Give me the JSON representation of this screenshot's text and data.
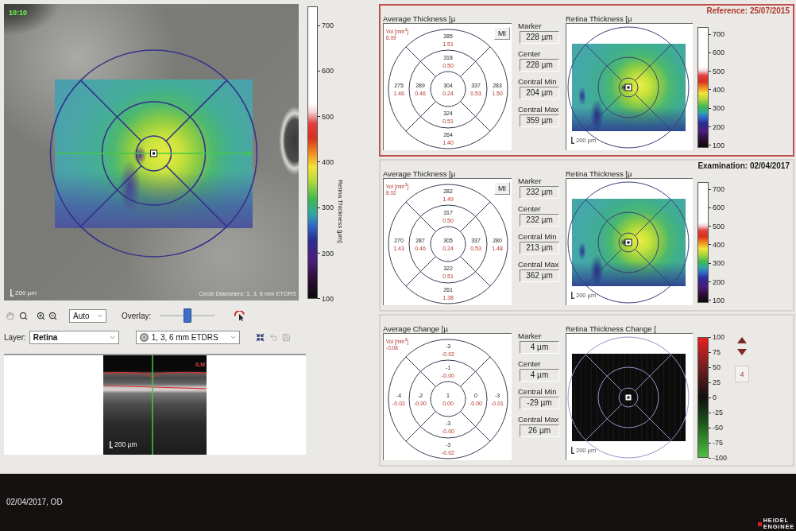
{
  "fundus": {
    "stamp": "10:10",
    "scale_label": "200 µm",
    "caption": "Circle Diameters: 1, 3, 6 mm ETDRS",
    "scale": {
      "title": "Retina Thickness [µm]",
      "ticks": [
        "700",
        "600",
        "500",
        "400",
        "300",
        "200",
        "100"
      ]
    }
  },
  "toolbar": {
    "zoom_mode": "Auto",
    "overlay_label": "Overlay:",
    "overlay": {
      "level": 0.5
    },
    "layer_label": "Layer:",
    "layer": "Retina",
    "grid": "1, 3, 6 mm ETDRS"
  },
  "bscan": {
    "layer_tag": "ILM",
    "scale_label": "200 µm"
  },
  "panels": [
    {
      "kind": "thickness",
      "highlighted": true,
      "heading": "Reference: 25/07/2015",
      "sector_title": "Average Thickness [µ",
      "volume_label": "Vol [mm$^{3}$]",
      "volume": "8.09",
      "mi": "MI",
      "sectors": [
        {
          "value": "285",
          "volume": "1.51"
        },
        {
          "value": "318",
          "volume": "0.50"
        },
        {
          "value": "275",
          "volume": "1.46"
        },
        {
          "value": "289",
          "volume": "0.46"
        },
        {
          "value": "304",
          "volume": "0.24"
        },
        {
          "value": "337",
          "volume": "0.53"
        },
        {
          "value": "283",
          "volume": "1.50"
        },
        {
          "value": "324",
          "volume": "0.51"
        },
        {
          "value": "264",
          "volume": "1.40"
        }
      ],
      "readings": [
        {
          "label": "Marker",
          "value": "228 µm"
        },
        {
          "label": "Center",
          "value": "228 µm"
        },
        {
          "label": "Central Min",
          "value": "204 µm"
        },
        {
          "label": "Central Max",
          "value": "359 µm"
        }
      ],
      "map_title": "Retina Thickness [µ",
      "map_scale": "200 µm",
      "ticks": [
        "700",
        "600",
        "500",
        "400",
        "300",
        "200",
        "100"
      ]
    },
    {
      "kind": "thickness",
      "highlighted": false,
      "heading": "Examination: 02/04/2017",
      "sector_title": "Average Thickness [µ",
      "volume_label": "Vol [mm$^{3}$]",
      "volume": "8.02",
      "mi": "MI",
      "sectors": [
        {
          "value": "282",
          "volume": "1.49"
        },
        {
          "value": "317",
          "volume": "0.50"
        },
        {
          "value": "270",
          "volume": "1.43"
        },
        {
          "value": "287",
          "volume": "0.46"
        },
        {
          "value": "305",
          "volume": "0.24"
        },
        {
          "value": "337",
          "volume": "0.53"
        },
        {
          "value": "280",
          "volume": "1.48"
        },
        {
          "value": "322",
          "volume": "0.51"
        },
        {
          "value": "261",
          "volume": "1.38"
        }
      ],
      "readings": [
        {
          "label": "Marker",
          "value": "232 µm"
        },
        {
          "label": "Center",
          "value": "232 µm"
        },
        {
          "label": "Central Min",
          "value": "213 µm"
        },
        {
          "label": "Central Max",
          "value": "362 µm"
        }
      ],
      "map_title": "Retina Thickness [µ",
      "map_scale": "200 µm",
      "ticks": [
        "700",
        "600",
        "500",
        "400",
        "300",
        "200",
        "100"
      ]
    },
    {
      "kind": "change",
      "highlighted": false,
      "sector_title": "Average Change [µ",
      "volume_label": "Vol [mm$^{3}$]",
      "volume": "-0.08",
      "sectors": [
        {
          "value": "-3",
          "volume": "-0.02"
        },
        {
          "value": "-1",
          "volume": "-0.00"
        },
        {
          "value": "-4",
          "volume": "-0.02"
        },
        {
          "value": "-2",
          "volume": "-0.00"
        },
        {
          "value": "1",
          "volume": "0.00"
        },
        {
          "value": "0",
          "volume": "-0.00"
        },
        {
          "value": "-3",
          "volume": "-0.01"
        },
        {
          "value": "-3",
          "volume": "-0.00"
        },
        {
          "value": "-3",
          "volume": "-0.02"
        }
      ],
      "readings": [
        {
          "label": "Marker",
          "value": "4 µm"
        },
        {
          "label": "Center",
          "value": "4 µm"
        },
        {
          "label": "Central Min",
          "value": "-29 µm"
        },
        {
          "label": "Central Max",
          "value": "26 µm"
        }
      ],
      "map_title": "Retina Thickness Change [",
      "map_scale": "200 µm",
      "ticks": [
        "100",
        "75",
        "50",
        "25",
        "0",
        "-25",
        "-50",
        "-75",
        "-100"
      ],
      "nav": {
        "count": "4"
      }
    }
  ],
  "footer": {
    "info": "02/04/2017, OD",
    "logo": [
      "HEIDEL",
      "ENGINEE"
    ]
  }
}
